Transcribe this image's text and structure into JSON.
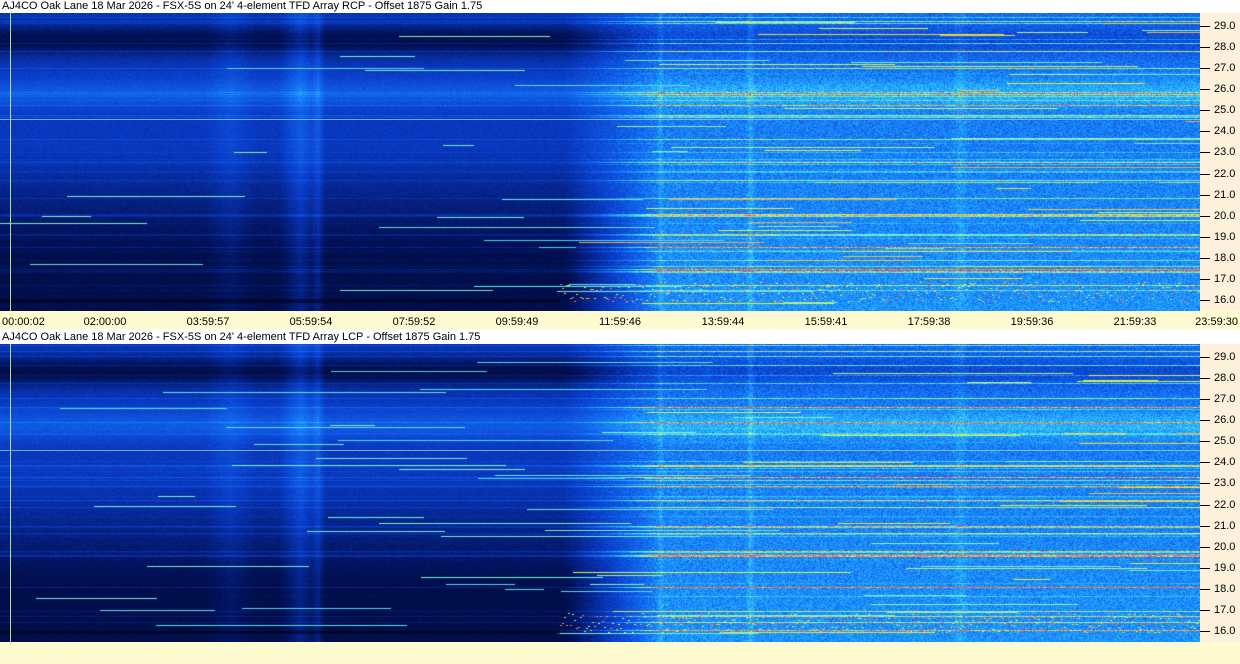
{
  "chart_data": [
    {
      "type": "heatmap",
      "title": "AJ4CO Oak Lane 18 Mar 2026 - FSX-5S on 24' 4-element TFD Array RCP  -  Offset 1875  Gain 1.75",
      "ylim": [
        15.5,
        29.6
      ],
      "y_ticks": [
        "16.0",
        "17.0",
        "18.0",
        "19.0",
        "20.0",
        "21.0",
        "22.0",
        "23.0",
        "24.0",
        "25.0",
        "26.0",
        "27.0",
        "28.0",
        "29.0"
      ],
      "x_ticks": [
        "00:00:02",
        "02:00:00",
        "03:59:57",
        "05:59:54",
        "07:59:52",
        "09:59:49",
        "11:59:46",
        "13:59:44",
        "15:59:41",
        "17:59:38",
        "19:59:36",
        "21:59:33",
        "23:59:30"
      ]
    },
    {
      "type": "heatmap",
      "title": "AJ4CO Oak Lane 18 Mar 2026 - FSX-5S on 24' 4-element TFD Array LCP  -  Offset 1875  Gain 1.75",
      "ylim": [
        15.5,
        29.6
      ],
      "y_ticks": [
        "16.0",
        "17.0",
        "18.0",
        "19.0",
        "20.0",
        "21.0",
        "22.0",
        "23.0",
        "24.0",
        "25.0",
        "26.0",
        "27.0",
        "28.0",
        "29.0"
      ]
    }
  ],
  "colors": {
    "background_dark": "#000820",
    "background_mid": "#0a3ec8",
    "signal_cyan": "#30d8ff",
    "signal_yellow": "#e8f040",
    "signal_red": "#ff5060",
    "freq_axis_bg": "#fdf1dc",
    "time_axis_bg": "#fffbd0"
  }
}
